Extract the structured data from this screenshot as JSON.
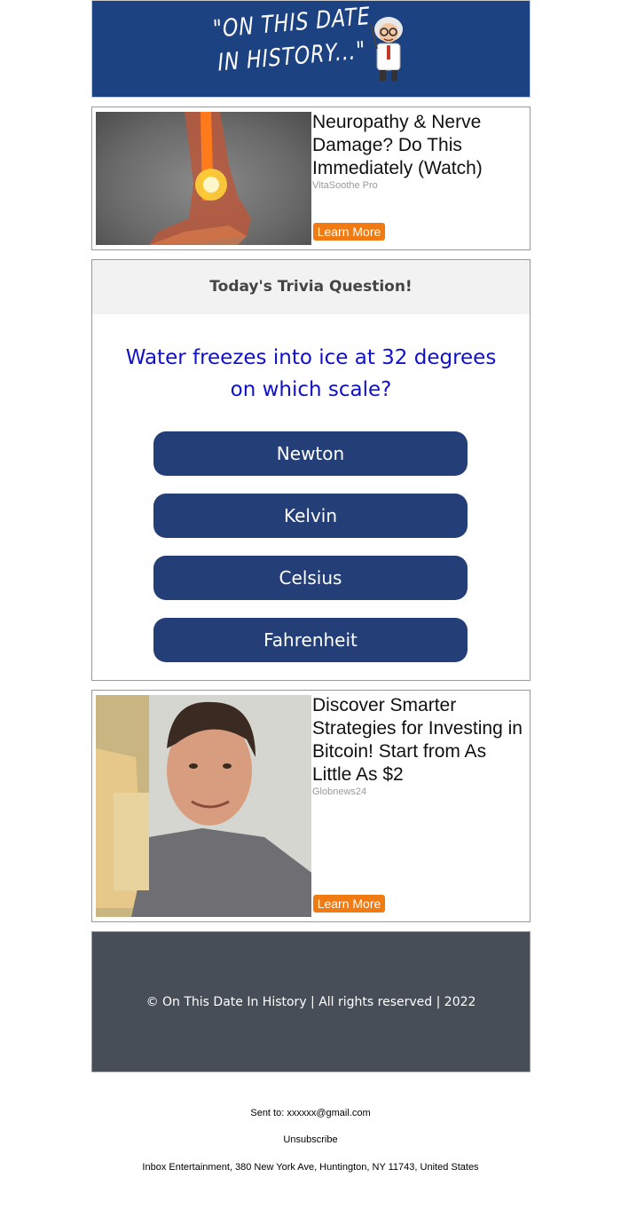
{
  "header": {
    "logo_line1": "\"ON THIS DATE",
    "logo_line2": "IN HISTORY...\"",
    "background": "#1c4281"
  },
  "ads": [
    {
      "title": "Neuropathy & Nerve Damage? Do This Immediately (Watch)",
      "source": "VitaSoothe Pro",
      "cta": "Learn More"
    },
    {
      "title": "Discover Smarter Strategies for Investing in Bitcoin! Start from As Little As $2",
      "source": "Globnews24",
      "cta": "Learn More"
    }
  ],
  "trivia": {
    "heading": "Today's Trivia Question!",
    "question": "Water freezes into ice at 32 degrees on which scale?",
    "answers": [
      "Newton",
      "Kelvin",
      "Celsius",
      "Fahrenheit"
    ],
    "question_color": "#1010cc",
    "button_color": "#243f77"
  },
  "footer": {
    "copyright": "© On This Date In History | All rights reserved | 2022"
  },
  "meta": {
    "sent_to": "Sent to: xxxxxx@gmail.com",
    "unsubscribe": "Unsubscribe",
    "address": "Inbox Entertainment, 380 New York Ave, Huntington, NY 11743, United States"
  },
  "colors": {
    "cta": "#f07b12",
    "footer_bg": "#474e58"
  }
}
